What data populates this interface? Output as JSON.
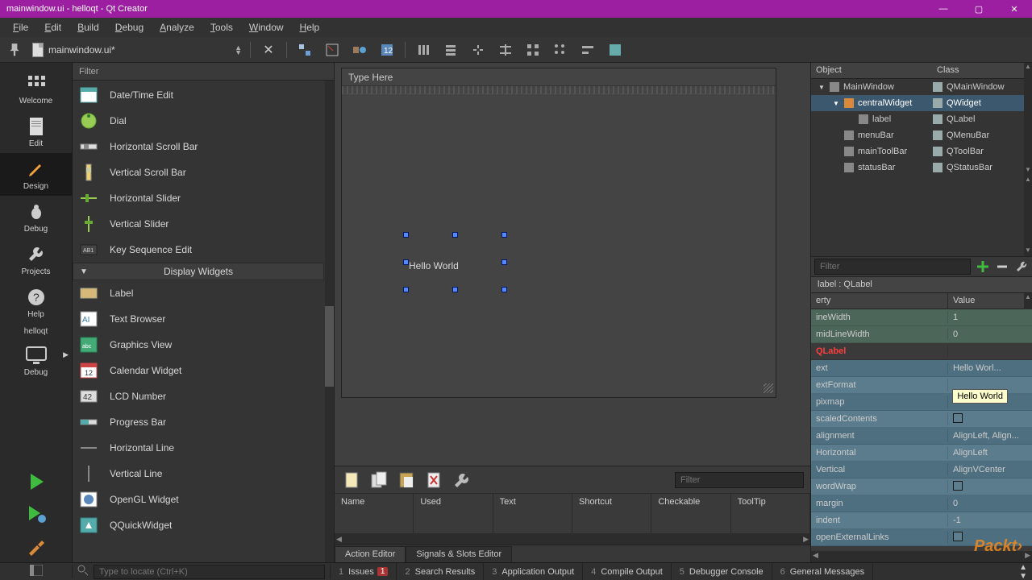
{
  "title": "mainwindow.ui - helloqt - Qt Creator",
  "menu": [
    "File",
    "Edit",
    "Build",
    "Debug",
    "Analyze",
    "Tools",
    "Window",
    "Help"
  ],
  "filename": "mainwindow.ui*",
  "typeHere": "Type Here",
  "labelText": "Hello World",
  "rail": {
    "welcome": "Welcome",
    "edit": "Edit",
    "design": "Design",
    "debug": "Debug",
    "projects": "Projects",
    "help": "Help",
    "project": "helloqt",
    "build": "Debug"
  },
  "widgets": {
    "filter": "Filter",
    "items": [
      "Date/Time Edit",
      "Dial",
      "Horizontal Scroll Bar",
      "Vertical Scroll Bar",
      "Horizontal Slider",
      "Vertical Slider",
      "Key Sequence Edit"
    ],
    "category": "Display Widgets",
    "items2": [
      "Label",
      "Text Browser",
      "Graphics View",
      "Calendar Widget",
      "LCD Number",
      "Progress Bar",
      "Horizontal Line",
      "Vertical Line",
      "OpenGL Widget",
      "QQuickWidget"
    ]
  },
  "actions": {
    "filter": "Filter",
    "cols": [
      "Name",
      "Used",
      "Text",
      "Shortcut",
      "Checkable",
      "ToolTip"
    ],
    "tabs": [
      "Action Editor",
      "Signals & Slots Editor"
    ]
  },
  "object": {
    "h": [
      "Object",
      "Class"
    ],
    "rows": [
      {
        "indent": 0,
        "name": "MainWindow",
        "cls": "QMainWindow",
        "arrow": "▼"
      },
      {
        "indent": 1,
        "name": "centralWidget",
        "cls": "QWidget",
        "arrow": "▼",
        "selected": true
      },
      {
        "indent": 2,
        "name": "label",
        "cls": "QLabel"
      },
      {
        "indent": 1,
        "name": "menuBar",
        "cls": "QMenuBar"
      },
      {
        "indent": 1,
        "name": "mainToolBar",
        "cls": "QToolBar"
      },
      {
        "indent": 1,
        "name": "statusBar",
        "cls": "QStatusBar"
      }
    ]
  },
  "props": {
    "filter": "Filter",
    "title": "label : QLabel",
    "headers": [
      "erty",
      "Value"
    ],
    "rows": [
      {
        "k": "ineWidth",
        "v": "1",
        "style": "green"
      },
      {
        "k": "midLineWidth",
        "v": "0",
        "style": "green"
      },
      {
        "k": "QLabel",
        "v": "",
        "style": "cat"
      },
      {
        "k": "ext",
        "v": "Hello Worl...",
        "style": "blue"
      },
      {
        "k": "extFormat",
        "v": "",
        "style": "blue-alt",
        "tooltip": "Hello World"
      },
      {
        "k": "pixmap",
        "v": "",
        "style": "blue"
      },
      {
        "k": "scaledContents",
        "v": "",
        "style": "blue-alt",
        "check": true
      },
      {
        "k": "alignment",
        "v": "AlignLeft, Align...",
        "style": "blue"
      },
      {
        "k": "    Horizontal",
        "v": "AlignLeft",
        "style": "blue-alt"
      },
      {
        "k": "    Vertical",
        "v": "AlignVCenter",
        "style": "blue"
      },
      {
        "k": "wordWrap",
        "v": "",
        "style": "blue-alt",
        "check": true
      },
      {
        "k": "margin",
        "v": "0",
        "style": "blue"
      },
      {
        "k": "indent",
        "v": "-1",
        "style": "blue-alt"
      },
      {
        "k": "openExternalLinks",
        "v": "",
        "style": "blue",
        "check": true
      }
    ]
  },
  "status": {
    "locate": "Type to locate (Ctrl+K)",
    "tabs": [
      {
        "n": "1",
        "t": "Issues",
        "badge": "1"
      },
      {
        "n": "2",
        "t": "Search Results"
      },
      {
        "n": "3",
        "t": "Application Output"
      },
      {
        "n": "4",
        "t": "Compile Output"
      },
      {
        "n": "5",
        "t": "Debugger Console"
      },
      {
        "n": "6",
        "t": "General Messages"
      }
    ]
  },
  "watermark": "Packt›"
}
